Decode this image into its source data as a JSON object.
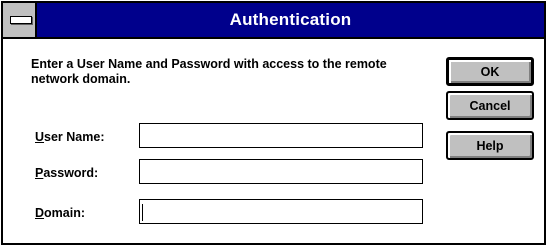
{
  "window": {
    "title": "Authentication",
    "colors": {
      "titlebar": "#00008c",
      "face": "#c0c0c0",
      "text": "#000000"
    }
  },
  "instructions": "Enter a User Name and Password with access to the remote network domain.",
  "fields": {
    "username": {
      "label_u": "U",
      "label_rest": "ser Name:",
      "value": ""
    },
    "password": {
      "label_u": "P",
      "label_rest": "assword:",
      "value": ""
    },
    "domain": {
      "label_u": "D",
      "label_rest": "omain:",
      "value": ""
    }
  },
  "buttons": {
    "ok": "OK",
    "cancel": "Cancel",
    "help": "Help"
  },
  "icons": {
    "system_menu": "system-menu-icon"
  }
}
